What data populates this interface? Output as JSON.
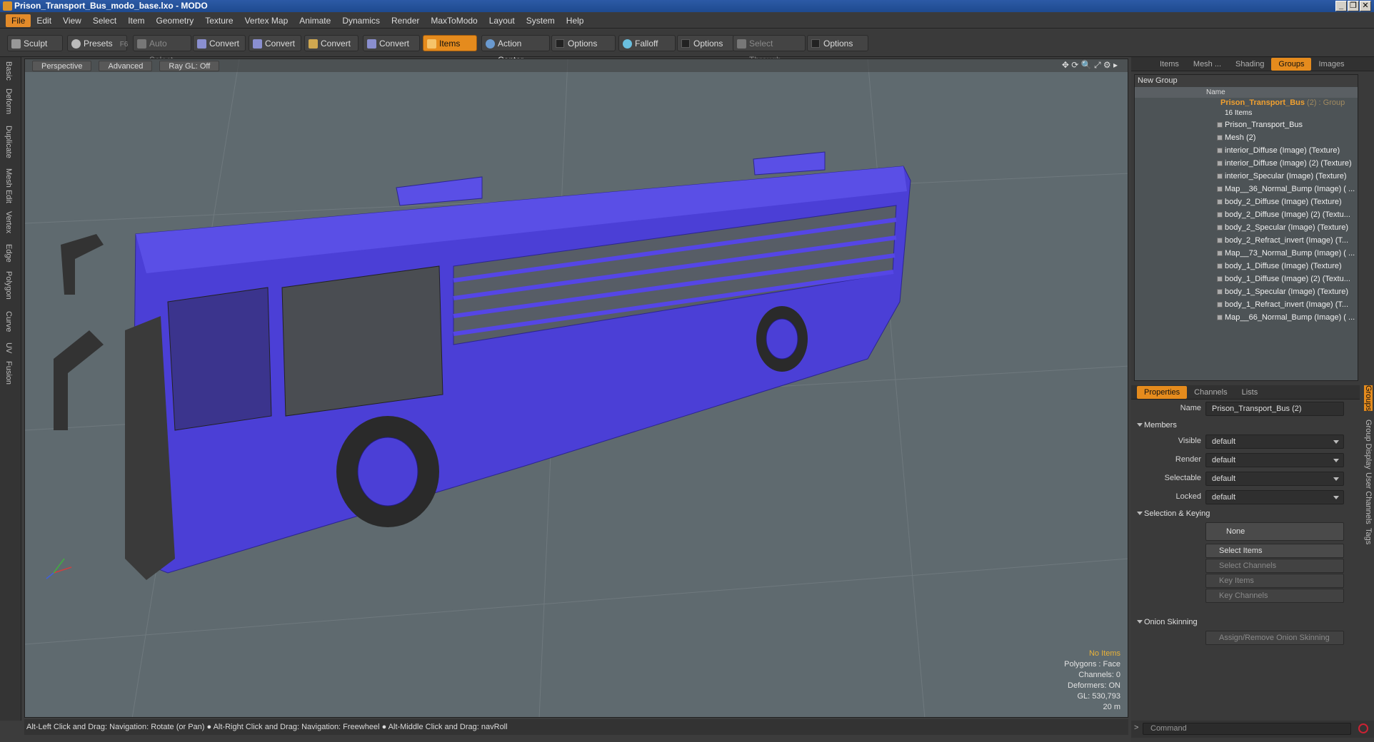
{
  "window": {
    "title": "Prison_Transport_Bus_modo_base.lxo - MODO"
  },
  "menu": [
    "File",
    "Edit",
    "View",
    "Select",
    "Item",
    "Geometry",
    "Texture",
    "Vertex Map",
    "Animate",
    "Dynamics",
    "Render",
    "MaxToModo",
    "Layout",
    "System",
    "Help"
  ],
  "toolbar": {
    "sculpt": "Sculpt",
    "presets": "Presets",
    "presets_key": "F6",
    "auto_select": "Auto Select",
    "convert1": "Convert",
    "convert2": "Convert",
    "convert3": "Convert",
    "convert4": "Convert",
    "items": "Items",
    "action_center": "Action Center",
    "options1": "Options",
    "falloff": "Falloff",
    "options2": "Options",
    "select_through": "Select Through",
    "options3": "Options"
  },
  "left_tabs": [
    "Basic",
    "Deform",
    "Duplicate",
    "Mesh Edit",
    "Vertex",
    "Edge",
    "Polygon",
    "Curve",
    "UV",
    "Fusion"
  ],
  "viewport": {
    "perspective": "Perspective",
    "advanced": "Advanced",
    "raygl": "Ray GL: Off",
    "stats": {
      "selection": "No Items",
      "polygons": "Polygons : Face",
      "channels": "Channels: 0",
      "deformers": "Deformers: ON",
      "gl": "GL: 530,793",
      "scale": "20 m"
    }
  },
  "status": "Alt-Left Click and Drag: Navigation: Rotate (or Pan) ● Alt-Right Click and Drag: Navigation: Freewheel ● Alt-Middle Click and Drag: navRoll",
  "right_tabs": [
    "Items",
    "Mesh ...",
    "Shading",
    "Groups",
    "Images"
  ],
  "groups": {
    "new_group": "New Group",
    "name_col": "Name",
    "group_name": "Prison_Transport_Bus",
    "group_suffix": "(2) : Group",
    "count": "16 Items",
    "items": [
      "Prison_Transport_Bus",
      "Mesh (2)",
      "interior_Diffuse (Image) (Texture)",
      "interior_Diffuse (Image) (2) (Texture)",
      "interior_Specular (Image) (Texture)",
      "Map__36_Normal_Bump (Image) ( ...",
      "body_2_Diffuse (Image) (Texture)",
      "body_2_Diffuse (Image) (2) (Textu...",
      "body_2_Specular (Image) (Texture)",
      "body_2_Refract_invert (Image) (T...",
      "Map__73_Normal_Bump (Image) ( ...",
      "body_1_Diffuse (Image) (Texture)",
      "body_1_Diffuse (Image) (2) (Textu...",
      "body_1_Specular (Image) (Texture)",
      "body_1_Refract_invert (Image) (T...",
      "Map__66_Normal_Bump (Image) ( ..."
    ]
  },
  "props_tabs": [
    "Properties",
    "Channels",
    "Lists"
  ],
  "properties": {
    "name_label": "Name",
    "name_value": "Prison_Transport_Bus (2)",
    "members": "Members",
    "visible_label": "Visible",
    "visible": "default",
    "render_label": "Render",
    "render": "default",
    "selectable_label": "Selectable",
    "selectable": "default",
    "locked_label": "Locked",
    "locked": "default",
    "selection_keying": "Selection & Keying",
    "none": "None",
    "select_items": "Select Items",
    "select_channels": "Select Channels",
    "key_items": "Key Items",
    "key_channels": "Key Channels",
    "onion": "Onion Skinning",
    "assign_onion": "Assign/Remove Onion Skinning"
  },
  "side_vtabs": [
    "Groups",
    "Group Display",
    "User Channels",
    "Tags"
  ],
  "command": {
    "placeholder": "Command"
  },
  "colors": {
    "accent": "#e58b1d",
    "bus_body": "#4a3fd8",
    "viewport_bg": "#5f6a6f"
  }
}
